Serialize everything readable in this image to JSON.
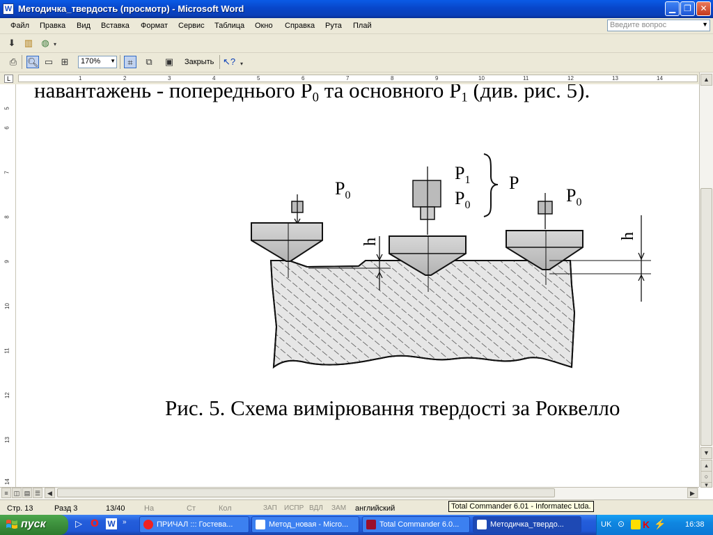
{
  "window": {
    "title": "Методичка_твердость (просмотр) - Microsoft Word",
    "app_icon": "W"
  },
  "menu": [
    "Файл",
    "Правка",
    "Вид",
    "Вставка",
    "Формат",
    "Сервис",
    "Таблица",
    "Окно",
    "Справка",
    "Рута",
    "Плай"
  ],
  "question_placeholder": "Введите вопрос",
  "toolbar": {
    "zoom": "170%",
    "close_label": "Закрыть"
  },
  "ruler": {
    "h_numbers": [
      "1",
      "2",
      "3",
      "4",
      "5",
      "6",
      "7",
      "8",
      "9",
      "10",
      "11",
      "12",
      "13",
      "14"
    ],
    "v_numbers": [
      "5",
      "6",
      "7",
      "8",
      "9",
      "10",
      "11",
      "12",
      "13",
      "14"
    ]
  },
  "document": {
    "top_line": "навантажень - попереднього P",
    "top_sub0": "0",
    "top_mid": " та основного P",
    "top_sub1": "1",
    "top_end": " (див. рис. 5).",
    "caption": "Рис. 5. Схема вимірювання твердості за Роквелло",
    "figure": {
      "labels": {
        "p0_left": "P",
        "p0_left_sub": "0",
        "p1": "P",
        "p1_sub": "1",
        "p0_mid": "P",
        "p0_mid_sub": "0",
        "p_total": "P",
        "p0_right": "P",
        "p0_right_sub": "0",
        "h_left": "h",
        "h_right": "h"
      }
    }
  },
  "status": {
    "page": "Стр. 13",
    "section": "Разд 3",
    "pages": "13/40",
    "at": "На",
    "line": "Ст",
    "col": "Кол",
    "rec": "ЗАП",
    "trk": "ИСПР",
    "ext": "ВДЛ",
    "ovr": "ЗАМ",
    "lang": "английский"
  },
  "tooltip": "Total Commander 6.01 - Informatec Ltda.",
  "taskbar": {
    "start": "пуск",
    "tasks": [
      "ПРИЧАЛ ::: Гостева...",
      "Метод_новая - Micro...",
      "Total Commander 6.0...",
      "Методичка_твердо..."
    ],
    "lang": "UK",
    "clock": "16:38"
  }
}
